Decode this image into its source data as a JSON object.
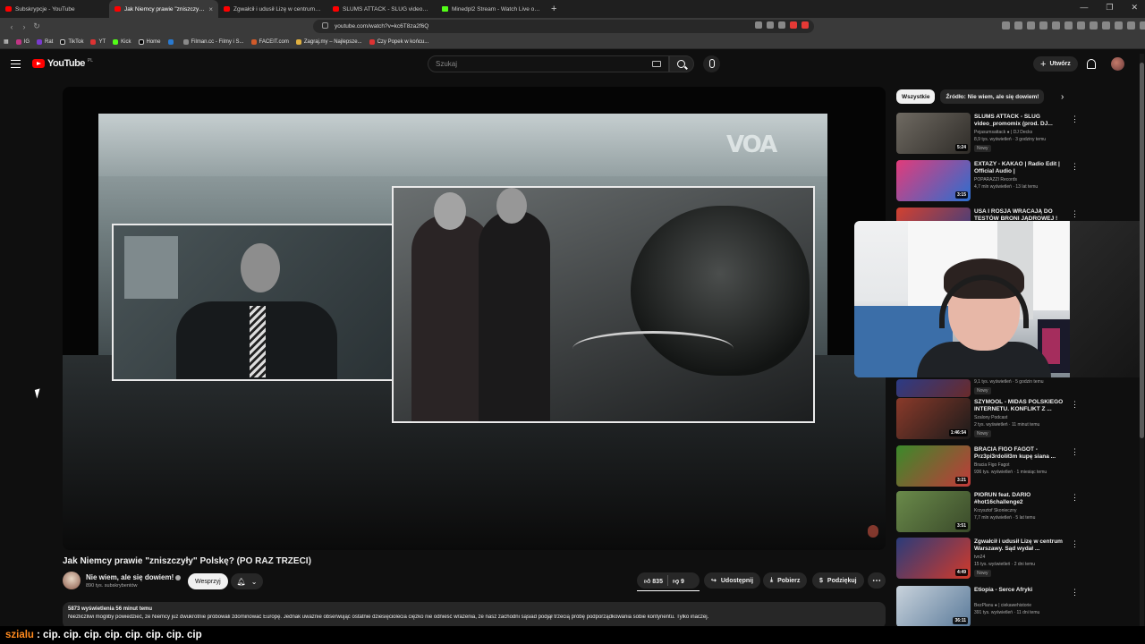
{
  "browser": {
    "tabs": [
      {
        "label": "Subskrypcje - YouTube",
        "icon": "youtube"
      },
      {
        "label": "Jak Niemcy prawie \"zniszczyły\" P",
        "icon": "youtube",
        "active": true
      },
      {
        "label": "Zgwałcił i udusił Lizę w centrum Wa",
        "icon": "youtube"
      },
      {
        "label": "SLUMS ATTACK - SLUG video_promo",
        "icon": "youtube"
      },
      {
        "label": "Minedpl2 Stream - Watch Live on Ki",
        "icon": "kick"
      }
    ],
    "new_tab": "+",
    "url": "youtube.com/watch?v=kc6T8za2f6Q",
    "bookmarks": [
      "IG",
      "Rat",
      "TikTok",
      "YT",
      "Kick",
      "Home",
      "",
      "Filman.cc - Filmy i S...",
      "FACEIT.com",
      "Zagraj.my – Najlepsze...",
      "Czy Popek w końcu..."
    ]
  },
  "header": {
    "logo": "YouTube",
    "logo_region": "PL",
    "search_placeholder": "Szukaj",
    "create_label": "Utwórz"
  },
  "video": {
    "title": "Jak Niemcy prawie \"zniszczyły\" Polskę? (PO RAZ TRZECI)",
    "channel": "Nie wiem, ale się dowiem!",
    "subs": "890 tys. subskrybentów",
    "support": "Wesprzyj",
    "likes": "835",
    "dislikes": "9",
    "share": "Udostępnij",
    "download": "Pobierz",
    "thanks": "Podziękuj",
    "player_watermark": "VOA",
    "meta": "5873 wyświetlenia  56 minut temu",
    "description": "Niezliczliwi mogliby powiedzieć, że Niemcy już dwukrotnie próbowali zdominować Europę. Jednak uważnie obserwując ostatnie dziesięciolecia ciężko nie odnieść wrażenia, że nasz zachodni sąsiad podjął trzecią próbę podporządkowania sobie kontynentu. Tylko inaczej."
  },
  "chips": [
    "Wszystkie",
    "Źródło: Nie wiem, ale się dowiem!"
  ],
  "recommendations": [
    {
      "title": "SLUMS ATTACK - SLUG video_promomix (prod. DJ...",
      "channel": "Pejasumsattack ● | DJ Decks",
      "views": "8,9 tys. wyświetleń · 3 godziny temu",
      "badge": "Nowy",
      "duration": "5:24",
      "colors": [
        "#6f6a62",
        "#2f2c28"
      ]
    },
    {
      "title": "EXTAZY - KAKAO | Radio Edit | Official Audio |",
      "channel": "POPARAZZI Records",
      "views": "4,7 mln wyświetleń · 13 lat temu",
      "badge": "",
      "duration": "3:15",
      "colors": [
        "#e23b7a",
        "#2b6fd0"
      ]
    },
    {
      "title": "USA I ROSJA WRACAJĄ DO TESTÓW BRONI JĄDROWEJ !",
      "channel": "",
      "views": "",
      "badge": "",
      "duration": "",
      "colors": [
        "#d3412f",
        "#2a3e8a"
      ]
    },
    {
      "title": "",
      "channel": "",
      "views": "9,1 tys. wyświetleń · 5 godzin temu",
      "badge": "Nowy",
      "duration": "",
      "colors": [
        "#2b3b86",
        "#6a2a2a"
      ]
    },
    {
      "title": "SZYMOOL - MIDAS POLSKIEGO INTERNETU. KONFLIKT Z ...",
      "channel": "Szalony Podcast",
      "views": "2 tys. wyświetleń · 11 minut temu",
      "badge": "Nowy",
      "duration": "1:46:54",
      "colors": [
        "#8a3a2a",
        "#1a1a1a"
      ]
    },
    {
      "title": "BRACIA FIGO FAGOT - Prz3pi3rdolił3m kupę siana ...",
      "channel": "Bracia Figo Fagot",
      "views": "936 tys. wyświetleń · 1 miesiąc temu",
      "badge": "",
      "duration": "3:21",
      "colors": [
        "#3a8a2a",
        "#c23a3a"
      ]
    },
    {
      "title": "PIORUN feat. DARIO #hot16challenge2",
      "channel": "Krzysztof Skonieczny",
      "views": "7,7 mln wyświetleń · 5 lat temu",
      "badge": "",
      "duration": "3:51",
      "colors": [
        "#6a8a4a",
        "#3a4a2a"
      ]
    },
    {
      "title": "Zgwałcił i udusił Lizę w centrum Warszawy. Sąd wydał ...",
      "channel": "tvn24",
      "views": "15 tys. wyświetleń · 2 dni temu",
      "badge": "Nowy",
      "duration": "4:49",
      "colors": [
        "#2a3b7a",
        "#d23a2a"
      ]
    },
    {
      "title": "Etiopia - Serce Afryki",
      "channel": "BezPlanu ● | ciekawehistorie",
      "views": "391 tys. wyświetleń · 11 dni temu",
      "badge": "",
      "duration": "36:11",
      "colors": [
        "#c9d3dc",
        "#5a7a9a"
      ]
    }
  ],
  "overlay_chat": {
    "user": "szialu",
    "message": ": cip. cip. cip. cip. cip. cip. cip. cip"
  }
}
